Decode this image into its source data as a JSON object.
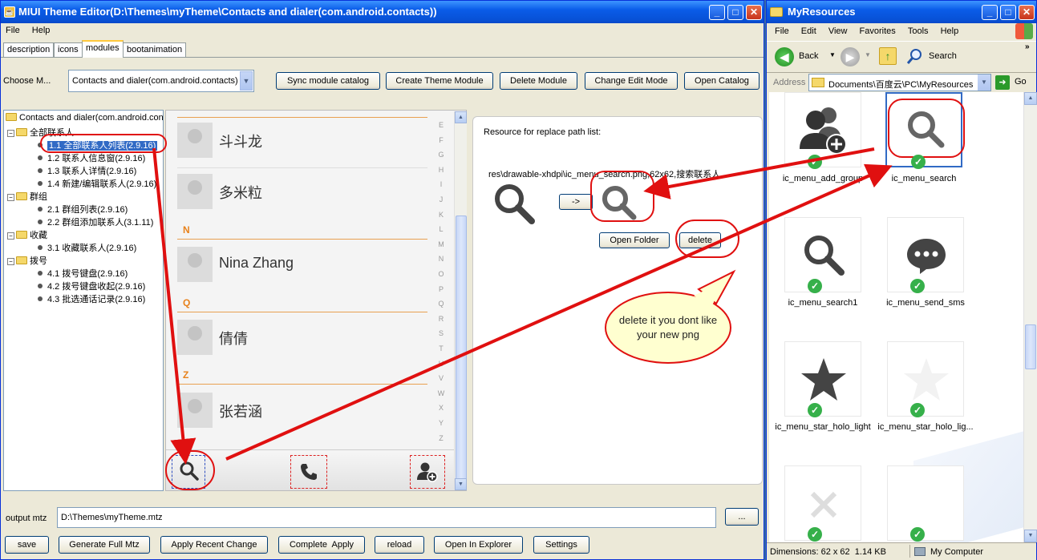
{
  "editor": {
    "title": "MIUI Theme Editor(D:\\Themes\\myTheme\\Contacts and dialer(com.android.contacts))",
    "menu": [
      "File",
      "Help"
    ],
    "tabs": [
      "description",
      "icons",
      "modules",
      "bootanimation"
    ],
    "choose_label": "Choose M...",
    "choose_value": "Contacts and dialer(com.android.contacts)",
    "toolbar": [
      "Sync module catalog",
      "Create Theme Module",
      "Delete Module",
      "Change Edit Mode",
      "Open Catalog"
    ],
    "tree": {
      "root": "Contacts and dialer(com.android.contacts)",
      "groups": [
        {
          "label": "全部联系人",
          "items": [
            "1.1 全部联系人列表(2.9.16)",
            "1.2 联系人信息窗(2.9.16)",
            "1.3 联系人详情(2.9.16)",
            "1.4 新建/编辑联系人(2.9.16)"
          ]
        },
        {
          "label": "群组",
          "items": [
            "2.1 群组列表(2.9.16)",
            "2.2 群组添加联系人(3.1.11)"
          ]
        },
        {
          "label": "收藏",
          "items": [
            "3.1 收藏联系人(2.9.16)"
          ]
        },
        {
          "label": "拨号",
          "items": [
            "4.1 拨号键盘(2.9.16)",
            "4.2 拨号键盘收起(2.9.16)",
            "4.3 批选通话记录(2.9.16)"
          ]
        }
      ]
    },
    "contacts": [
      "斗斗龙",
      "多米粒",
      "Nina Zhang",
      "倩倩",
      "张若涵"
    ],
    "sections": [
      "N",
      "Q",
      "Z"
    ],
    "alphabet": [
      "E",
      "F",
      "G",
      "H",
      "I",
      "J",
      "K",
      "L",
      "M",
      "N",
      "O",
      "P",
      "Q",
      "R",
      "S",
      "T",
      "U",
      "V",
      "W",
      "X",
      "Y",
      "Z"
    ],
    "resource": {
      "header": "Resource for replace path list:",
      "path": "res\\drawable-xhdpi\\ic_menu_search.png,62x62,搜索联系人",
      "arrow": "->",
      "open_folder": "Open Folder",
      "delete": "delete"
    },
    "callout": "delete it you dont like your new png",
    "output_label": "output mtz",
    "output_value": "D:\\Themes\\myTheme.mtz",
    "browse": "...",
    "bottom_buttons": [
      "save",
      "Generate Full Mtz",
      "Apply Recent Change",
      "Complete  Apply",
      "reload",
      "Open In Explorer",
      "Settings"
    ]
  },
  "explorer": {
    "title": "MyResources",
    "menu": [
      "File",
      "Edit",
      "View",
      "Favorites",
      "Tools",
      "Help"
    ],
    "back": "Back",
    "search": "Search",
    "address_label": "Address",
    "address_value": "Documents\\百度云\\PC\\MyResources",
    "go": "Go",
    "icons": [
      "ic_menu_add_group",
      "ic_menu_search",
      "ic_menu_search1",
      "ic_menu_send_sms",
      "ic_menu_star_holo_light",
      "ic_menu_star_holo_lig..."
    ],
    "status_left": "Dimensions: 62 x 62  1.14 KB",
    "status_right": "My Computer"
  },
  "colors": {
    "accent_red": "#e01010",
    "selection": "#316ac5",
    "xp_blue": "#0a5ce8",
    "section_orange": "#e8821c"
  }
}
